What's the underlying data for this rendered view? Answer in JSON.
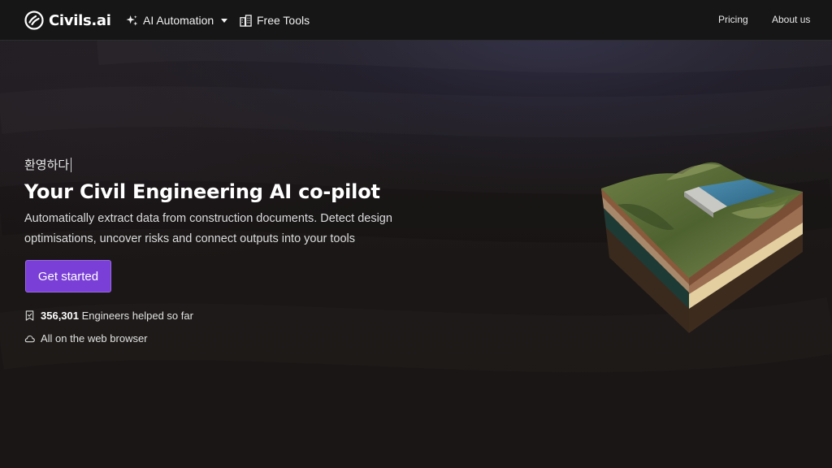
{
  "nav": {
    "brand": "Civils.ai",
    "ai_automation": "AI Automation",
    "free_tools": "Free Tools",
    "pricing": "Pricing",
    "about": "About us"
  },
  "hero": {
    "greeting": "환영하다",
    "headline": "Your Civil Engineering AI co-pilot",
    "subtext": "Automatically extract data from construction documents. Detect design optimisations, uncover risks and connect outputs into your tools",
    "cta_label": "Get started",
    "stat_count": "356,301",
    "stat_suffix": " Engineers helped so far",
    "browser_note": "All on the web browser"
  },
  "icons": {
    "logo": "civils-logo-icon",
    "ai": "sparkle-icon",
    "tools": "buildings-icon",
    "stat": "bookmark-check-icon",
    "browser": "cloud-icon",
    "illustration": "terrain-cross-section-illustration"
  },
  "colors": {
    "background": "#1b1716",
    "navbar": "#161616",
    "accent": "#7a3fd6"
  }
}
